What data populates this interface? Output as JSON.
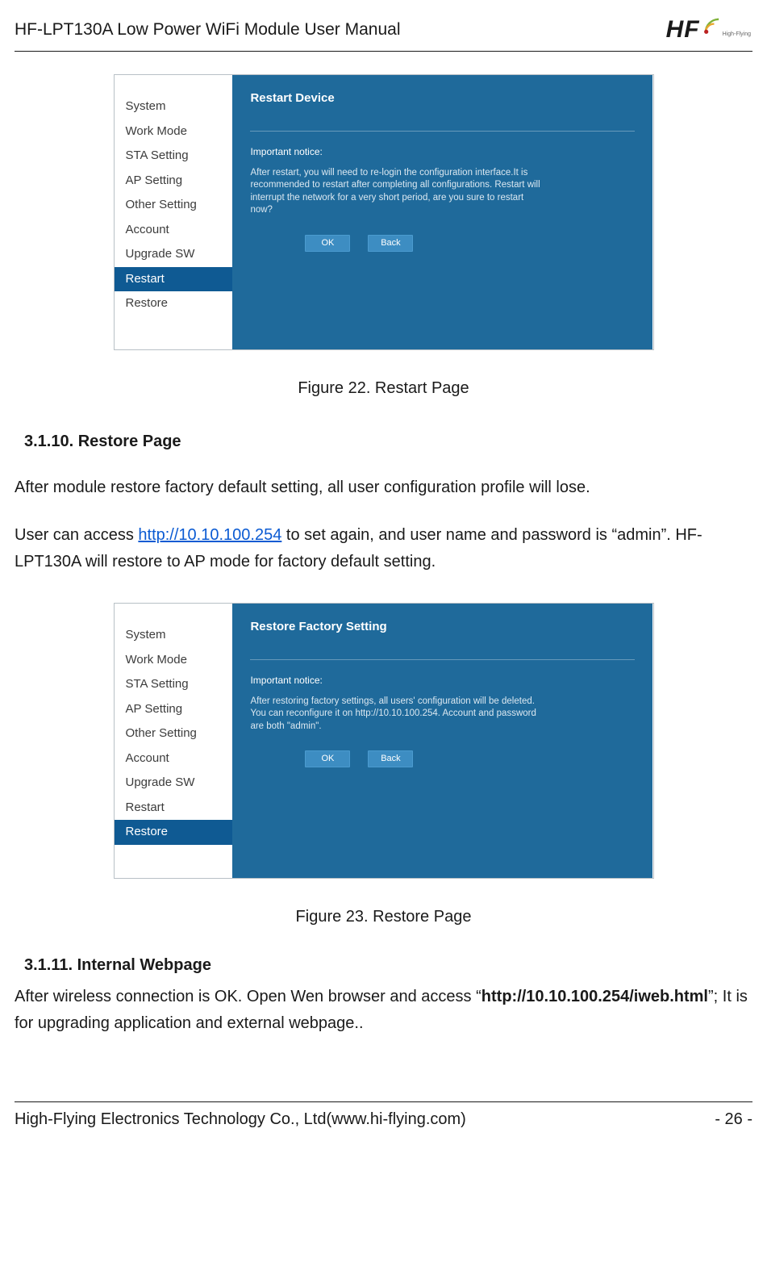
{
  "header": {
    "title": "HF-LPT130A Low Power WiFi Module User Manual",
    "logo_text": "HF",
    "logo_sub": "High-Flying"
  },
  "fig22": {
    "nav": [
      "System",
      "Work Mode",
      "STA Setting",
      "AP Setting",
      "Other Setting",
      "Account",
      "Upgrade SW",
      "Restart",
      "Restore"
    ],
    "selected": "Restart",
    "panel_title": "Restart Device",
    "notice_label": "Important notice:",
    "notice_body": "After restart, you will need to re-login the configuration interface.It is recommended to restart after completing all configurations. Restart will interrupt the network for a very short period, are you sure to restart now?",
    "ok": "OK",
    "back": "Back",
    "caption": "Figure 22.   Restart Page"
  },
  "sec1": {
    "heading": "3.1.10.  Restore Page",
    "p1": "After module restore factory default setting, all user configuration profile will lose.",
    "p2a": "User can access ",
    "p2_link": "http://10.10.100.254",
    "p2b": " to set again, and user name and password is “admin”. HF-LPT130A will restore to AP mode for factory default setting."
  },
  "fig23": {
    "nav": [
      "System",
      "Work Mode",
      "STA Setting",
      "AP Setting",
      "Other Setting",
      "Account",
      "Upgrade SW",
      "Restart",
      "Restore"
    ],
    "selected": "Restore",
    "panel_title": "Restore Factory Setting",
    "notice_label": "Important notice:",
    "notice_body": "After restoring factory settings, all users' configuration will be deleted. You can reconfigure it on http://10.10.100.254. Account and password are both \"admin\".",
    "ok": "OK",
    "back": "Back",
    "caption": "Figure 23.   Restore Page"
  },
  "sec2": {
    "heading": "3.1.11.  Internal Webpage",
    "p_a": "After wireless connection is OK. Open Wen browser and access “",
    "p_bold": "http://10.10.100.254/iweb.html",
    "p_b": "”; It is for upgrading application and external webpage.."
  },
  "footer": {
    "left": "High-Flying Electronics Technology Co., Ltd(www.hi-flying.com)",
    "right": "- 26 -"
  }
}
